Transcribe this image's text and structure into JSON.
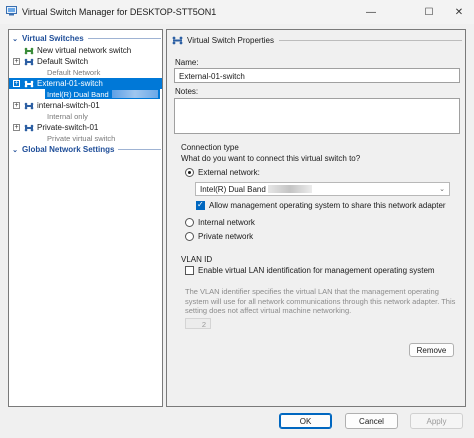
{
  "window": {
    "title": "Virtual Switch Manager for DESKTOP-STT5ON1",
    "minimize_glyph": "—",
    "maximize_glyph": "☐",
    "close_glyph": "✕",
    "app_icon": "hyper-v-icon"
  },
  "sidebar": {
    "virtual_switches_header": "Virtual Switches",
    "global_settings_header": "Global Network Settings",
    "new_switch": "New virtual network switch",
    "items": [
      {
        "label": "Default Switch",
        "subtitle": "Default Network",
        "expander": "+"
      },
      {
        "label": "External-01-switch",
        "subtitle": "Intel(R) Dual Band",
        "expander": "+",
        "selected": true
      },
      {
        "label": "internal-switch-01",
        "subtitle": "Internal only",
        "expander": "+"
      },
      {
        "label": "Private-switch-01",
        "subtitle": "Private virtual switch",
        "expander": "+"
      }
    ]
  },
  "properties": {
    "header": "Virtual Switch Properties",
    "name_label": "Name:",
    "name_value": "External-01-switch",
    "notes_label": "Notes:",
    "notes_value": "",
    "connection_type_label": "Connection type",
    "connection_question": "What do you want to connect this virtual switch to?",
    "external_network": "External network:",
    "adapter_value": "Intel(R) Dual Band",
    "allow_mgmt": "Allow management operating system to share this network adapter",
    "internal_network": "Internal network",
    "private_network": "Private network",
    "vlan_label": "VLAN ID",
    "enable_vlan": "Enable virtual LAN identification for management operating system",
    "vlan_note": "The VLAN identifier specifies the virtual LAN that the management operating system will use for all network communications through this network adapter. This setting does not affect virtual machine networking.",
    "vlan_value": "2",
    "remove_button": "Remove",
    "selected_connection": "external",
    "allow_mgmt_checked": true,
    "vlan_checked": false
  },
  "footer": {
    "ok": "OK",
    "cancel": "Cancel",
    "apply": "Apply"
  },
  "colors": {
    "selection": "#0078d7",
    "section_header": "#1f4e99",
    "switch_icon": "#3a8c3a"
  }
}
